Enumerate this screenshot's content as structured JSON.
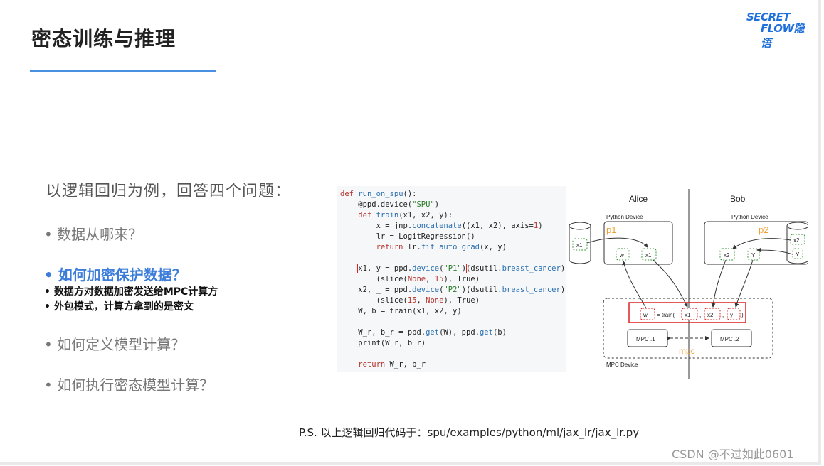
{
  "slide": {
    "title": "密态训练与推理",
    "logo": {
      "line1": "SECRET",
      "line2": "FLOW隐语"
    },
    "intro": "以逻辑回归为例，回答四个问题：",
    "questions": [
      {
        "text": "• 数据从哪来？"
      },
      {
        "text": "• 如何加密保护数据？"
      },
      {
        "text": "• 如何定义模型计算？"
      },
      {
        "text": "• 如何执行密态模型计算？"
      }
    ],
    "sub_points": [
      "• 数据方对数据加密发送给MPC计算方",
      "• 外包模式，计算方拿到的是密文"
    ],
    "footnote": "P.S. 以上逻辑回归代码于：spu/examples/python/ml/jax_lr/jax_lr.py",
    "watermark": "CSDN @不过如此0601"
  },
  "code": {
    "l1_kw": "def",
    "l1_fn": "run_on_spu",
    "l1_rest": "():",
    "l2_a": "    @ppd.device(",
    "l2_s": "\"SPU\"",
    "l2_b": ")",
    "l3_kw": "    def",
    "l3_fn": " train",
    "l3_rest": "(x1, x2, y):",
    "l4_a": "        x = jnp.",
    "l4_f": "concatenate",
    "l4_b": "((x1, x2), axis=",
    "l4_n": "1",
    "l4_c": ")",
    "l5": "        lr = LogitRegression()",
    "l6_kw": "        return",
    "l6_a": " lr.",
    "l6_f": "fit_auto_grad",
    "l6_b": "(x, y)",
    "l8_a": "x1, y = ppd.",
    "l8_f": "device",
    "l8_b": "(",
    "l8_s": "\"P1\"",
    "l8_c": ")",
    "l8_d": "(dsutil.",
    "l8_g": "breast_cancer",
    "l8_e": ")",
    "l9_a": "        (slice(",
    "l9_n": "None",
    "l9_b": ", ",
    "l9_n2": "15",
    "l9_c": "), True)",
    "l10_a": "    x2, _ = ppd.",
    "l10_f": "device",
    "l10_b": "(",
    "l10_s": "\"P2\"",
    "l10_c": ")(dsutil.",
    "l10_g": "breast_cancer",
    "l10_d": ")",
    "l11_a": "        (slice(",
    "l11_n": "15",
    "l11_b": ", ",
    "l11_n2": "None",
    "l11_c": "), True)",
    "l12": "    W, b = train(x1, x2, y)",
    "l14_a": "    W_r, b_r = ppd.",
    "l14_f": "get",
    "l14_b": "(W), ppd.",
    "l14_f2": "get",
    "l14_c": "(b)",
    "l15": "    print(W_r, b_r)",
    "l17_kw": "    return",
    "l17_rest": " W_r, b_r"
  },
  "diagram": {
    "alice": "Alice",
    "bob": "Bob",
    "python_device": "Python Device",
    "p1": "p1",
    "p2": "p2",
    "x1": "x1",
    "w": "w",
    "x2": "x2",
    "Y": "Y",
    "train_w": "w_",
    "train_eq": "= train(",
    "train_x1": "x1_",
    "train_x2": "x2_",
    "train_y": "y_",
    "comma": ",",
    "paren": ")",
    "mpc1": "MPC .1",
    "mpc2": "MPC .2",
    "mpc": "mpc",
    "mpc_device": "MPC Device"
  },
  "colors": {
    "accent": "#4a90e2",
    "active_question": "#3c7ddb",
    "orange": "#f0a030",
    "green_dash": "#3a9a3a",
    "red": "#e02020"
  }
}
